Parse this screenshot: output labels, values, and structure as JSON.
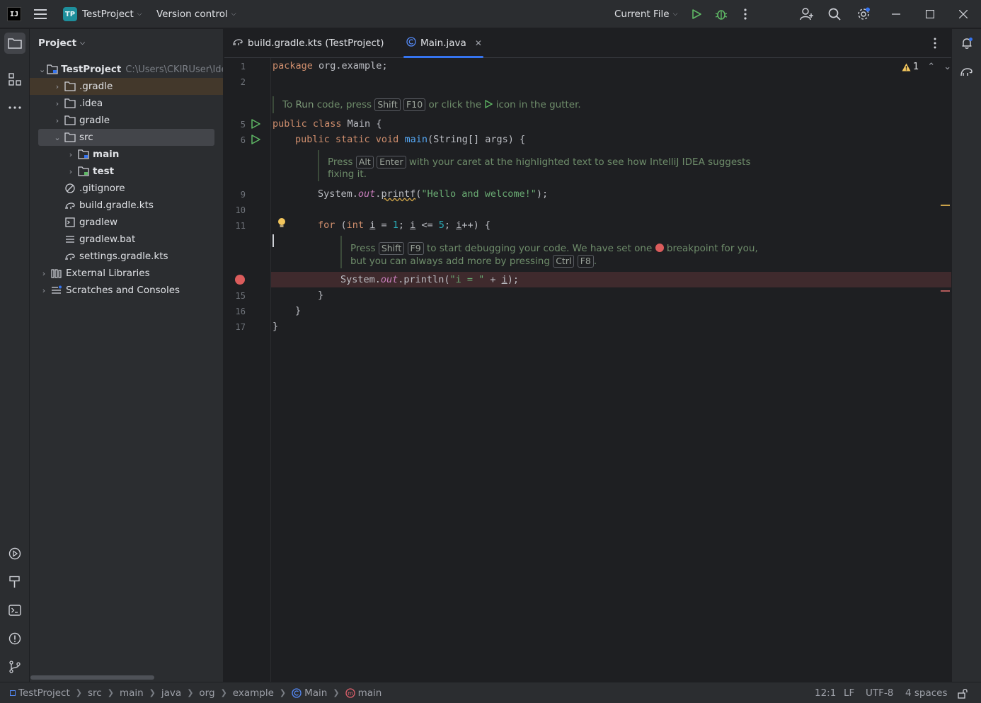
{
  "titlebar": {
    "logo": "IJ",
    "project_badge": "TP",
    "project_name": "TestProject",
    "vcs_label": "Version control",
    "run_config": "Current File"
  },
  "project_panel": {
    "title": "Project",
    "tree": [
      {
        "label": "TestProject",
        "path": "C:\\Users\\CKIRUser\\Ide",
        "icon": "module-folder-icon",
        "expanded": true
      },
      {
        "label": ".gradle",
        "icon": "folder-icon"
      },
      {
        "label": ".idea",
        "icon": "folder-icon"
      },
      {
        "label": "gradle",
        "icon": "folder-icon"
      },
      {
        "label": "src",
        "icon": "folder-icon",
        "expanded": true
      },
      {
        "label": "main",
        "icon": "source-folder-icon"
      },
      {
        "label": "test",
        "icon": "test-folder-icon"
      },
      {
        "label": ".gitignore",
        "icon": "ignore-file-icon"
      },
      {
        "label": "build.gradle.kts",
        "icon": "gradle-file-icon"
      },
      {
        "label": "gradlew",
        "icon": "shell-file-icon"
      },
      {
        "label": "gradlew.bat",
        "icon": "text-file-icon"
      },
      {
        "label": "settings.gradle.kts",
        "icon": "gradle-file-icon"
      },
      {
        "label": "External Libraries",
        "icon": "libraries-icon"
      },
      {
        "label": "Scratches and Consoles",
        "icon": "scratches-icon"
      }
    ]
  },
  "tabs": [
    {
      "label": "build.gradle.kts (TestProject)",
      "active": false
    },
    {
      "label": "Main.java",
      "active": true
    }
  ],
  "editor": {
    "warning_count": "1",
    "line_numbers": [
      "1",
      "2",
      "5",
      "6",
      "9",
      "10",
      "11",
      "15",
      "16",
      "17"
    ],
    "code": {
      "l1_kw": "package",
      "l1_rest": " org.example;",
      "l5_kw": "public class",
      "l5_rest": " Main {",
      "l6_kw": "public static void",
      "l6_fn": "main",
      "l6_rest": "(String[] args) {",
      "l9_a": "System.",
      "l9_out": "out",
      "l9_b": ".",
      "l9_call": "printf",
      "l9_c": "(",
      "l9_str": "\"Hello and welcome!\"",
      "l9_d": ");",
      "l11_kw": "for",
      "l11_a": " (",
      "l11_int": "int",
      "l11_b": " ",
      "l11_i1": "i",
      "l11_c": " = ",
      "l11_n1": "1",
      "l11_d": "; ",
      "l11_i2": "i",
      "l11_e": " <= ",
      "l11_n2": "5",
      "l11_f": "; ",
      "l11_i3": "i",
      "l11_g": "++) {",
      "l14_a": "System.",
      "l14_out": "out",
      "l14_b": ".println(",
      "l14_str": "\"i = \"",
      "l14_c": " + ",
      "l14_i": "i",
      "l14_d": ");",
      "l15": "}",
      "l16": "}",
      "l17": "}"
    },
    "hint1": {
      "a": "To ",
      "b": "Run",
      "c": " code, press ",
      "k1": "Shift",
      "k2": "F10",
      "d": " or click the ",
      "e": " icon in the gutter."
    },
    "hint2": {
      "a": "Press ",
      "k1": "Alt",
      "k2": "Enter",
      "b": " with your caret at the highlighted text to see how IntelliJ IDEA suggests",
      "c": "fixing it."
    },
    "hint3": {
      "a": "Press ",
      "k1": "Shift",
      "k2": "F9",
      "b": " to start debugging your code. We have set one ",
      "c": " breakpoint for you,",
      "d": "but you can always add more by pressing ",
      "k3": "Ctrl",
      "k4": "F8",
      "e": "."
    }
  },
  "statusbar": {
    "breadcrumbs": [
      "TestProject",
      "src",
      "main",
      "java",
      "org",
      "example",
      "Main",
      "main"
    ],
    "position": "12:1",
    "line_sep": "LF",
    "encoding": "UTF-8",
    "indent": "4 spaces"
  },
  "colors": {
    "accent": "#3574f0",
    "breakpoint": "#db5c5c",
    "run": "#5fb865"
  }
}
